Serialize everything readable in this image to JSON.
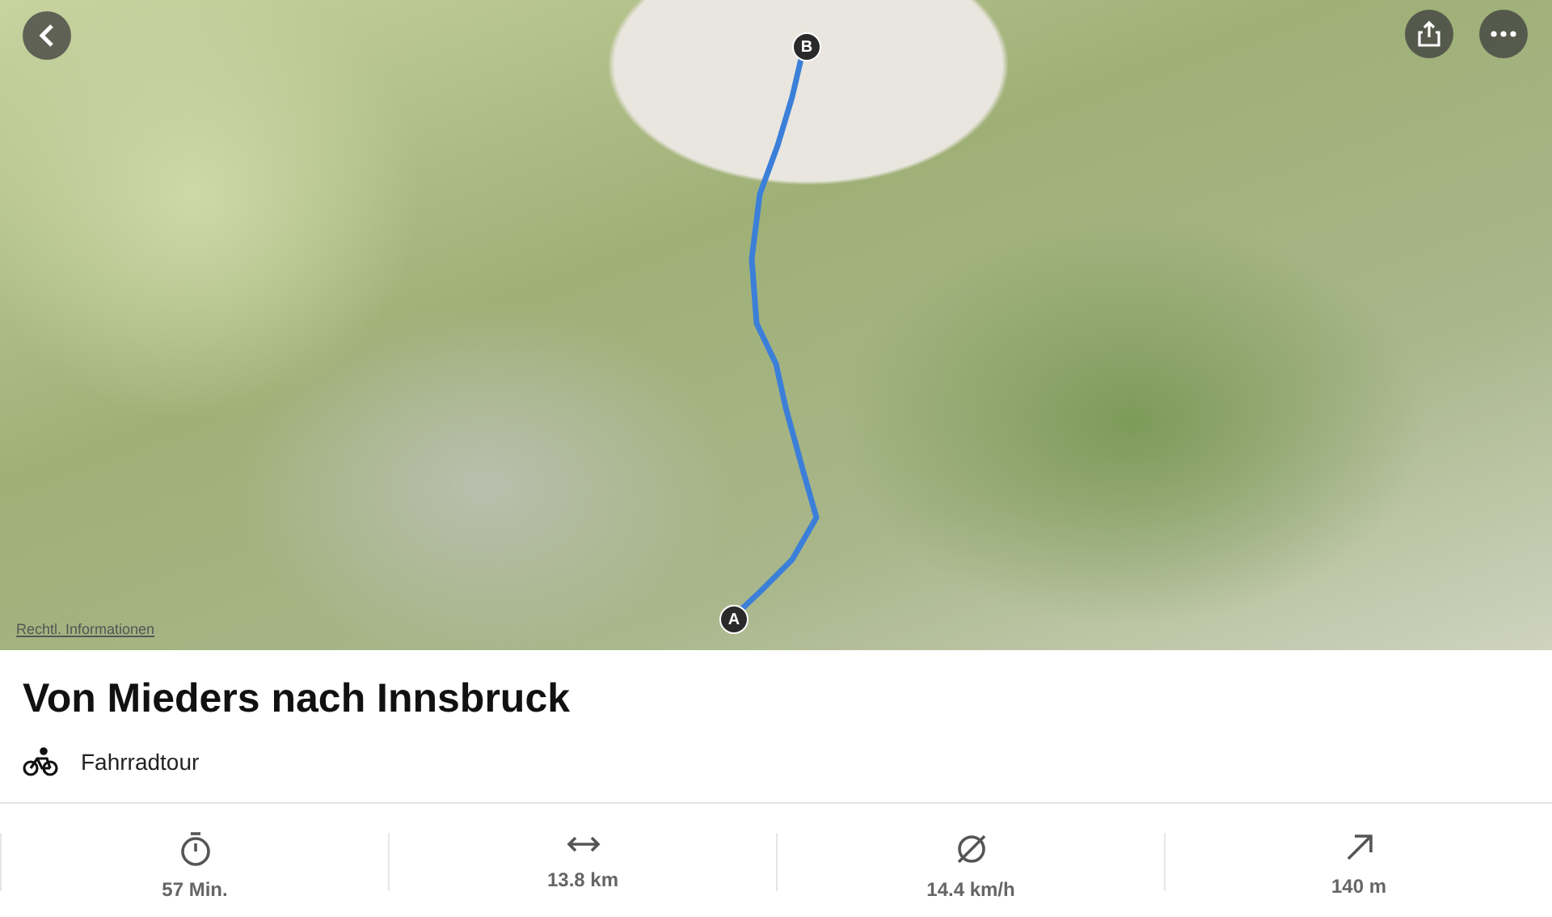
{
  "map": {
    "legal_link": "Rechtl. Informationen",
    "start_marker": "A",
    "end_marker": "B"
  },
  "tour": {
    "title": "Von Mieders nach Innsbruck",
    "type": "Fahrradtour"
  },
  "stats": [
    {
      "kind": "duration",
      "value": "57 Min."
    },
    {
      "kind": "distance",
      "value": "13.8 km"
    },
    {
      "kind": "speed",
      "value": "14.4 km/h"
    },
    {
      "kind": "ascent",
      "value": "140 m"
    }
  ]
}
